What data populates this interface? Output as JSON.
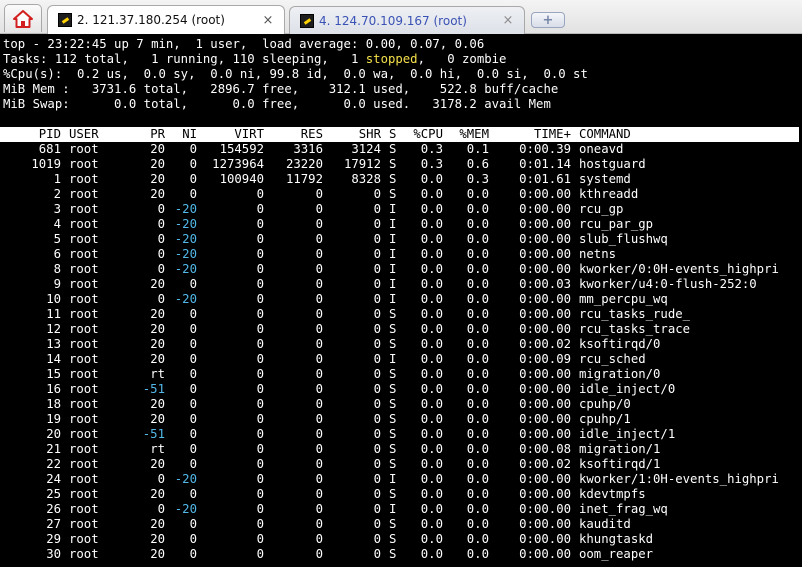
{
  "tabs": [
    {
      "label": "2. 121.37.180.254 (root)",
      "close": "×",
      "active": true
    },
    {
      "label": "4. 124.70.109.167 (root)",
      "close": "×",
      "active": false
    }
  ],
  "newtab_label": "+",
  "summary": {
    "top_line": "top - 23:22:45 up 7 min,  1 user,  load average: 0.00, 0.07, 0.06",
    "tasks_prefix": "Tasks: 112 total,   1 running, 110 sleeping,   1 ",
    "tasks_stopped": "stopped",
    "tasks_suffix": ",   0 zombie",
    "cpu_line": "%Cpu(s):  0.2 us,  0.0 sy,  0.0 ni, 99.8 id,  0.0 wa,  0.0 hi,  0.0 si,  0.0 st",
    "mem_line": "MiB Mem :   3731.6 total,   2896.7 free,    312.1 used,    522.8 buff/cache",
    "swap_line": "MiB Swap:      0.0 total,      0.0 free,      0.0 used.   3178.2 avail Mem"
  },
  "columns": [
    "PID",
    "USER",
    "PR",
    "NI",
    "VIRT",
    "RES",
    "SHR",
    "S",
    "%CPU",
    "%MEM",
    "TIME+",
    "COMMAND"
  ],
  "processes": [
    [
      "681",
      "root",
      "20",
      "0",
      "154592",
      "3316",
      "3124",
      "S",
      "0.3",
      "0.1",
      "0:00.39",
      "oneavd"
    ],
    [
      "1019",
      "root",
      "20",
      "0",
      "1273964",
      "23220",
      "17912",
      "S",
      "0.3",
      "0.6",
      "0:01.14",
      "hostguard"
    ],
    [
      "1",
      "root",
      "20",
      "0",
      "100940",
      "11792",
      "8328",
      "S",
      "0.0",
      "0.3",
      "0:01.61",
      "systemd"
    ],
    [
      "2",
      "root",
      "20",
      "0",
      "0",
      "0",
      "0",
      "S",
      "0.0",
      "0.0",
      "0:00.00",
      "kthreadd"
    ],
    [
      "3",
      "root",
      "0",
      "-20",
      "0",
      "0",
      "0",
      "I",
      "0.0",
      "0.0",
      "0:00.00",
      "rcu_gp"
    ],
    [
      "4",
      "root",
      "0",
      "-20",
      "0",
      "0",
      "0",
      "I",
      "0.0",
      "0.0",
      "0:00.00",
      "rcu_par_gp"
    ],
    [
      "5",
      "root",
      "0",
      "-20",
      "0",
      "0",
      "0",
      "I",
      "0.0",
      "0.0",
      "0:00.00",
      "slub_flushwq"
    ],
    [
      "6",
      "root",
      "0",
      "-20",
      "0",
      "0",
      "0",
      "I",
      "0.0",
      "0.0",
      "0:00.00",
      "netns"
    ],
    [
      "8",
      "root",
      "0",
      "-20",
      "0",
      "0",
      "0",
      "I",
      "0.0",
      "0.0",
      "0:00.00",
      "kworker/0:0H-events_highpri"
    ],
    [
      "9",
      "root",
      "20",
      "0",
      "0",
      "0",
      "0",
      "I",
      "0.0",
      "0.0",
      "0:00.03",
      "kworker/u4:0-flush-252:0"
    ],
    [
      "10",
      "root",
      "0",
      "-20",
      "0",
      "0",
      "0",
      "I",
      "0.0",
      "0.0",
      "0:00.00",
      "mm_percpu_wq"
    ],
    [
      "11",
      "root",
      "20",
      "0",
      "0",
      "0",
      "0",
      "S",
      "0.0",
      "0.0",
      "0:00.00",
      "rcu_tasks_rude_"
    ],
    [
      "12",
      "root",
      "20",
      "0",
      "0",
      "0",
      "0",
      "S",
      "0.0",
      "0.0",
      "0:00.00",
      "rcu_tasks_trace"
    ],
    [
      "13",
      "root",
      "20",
      "0",
      "0",
      "0",
      "0",
      "S",
      "0.0",
      "0.0",
      "0:00.02",
      "ksoftirqd/0"
    ],
    [
      "14",
      "root",
      "20",
      "0",
      "0",
      "0",
      "0",
      "I",
      "0.0",
      "0.0",
      "0:00.09",
      "rcu_sched"
    ],
    [
      "15",
      "root",
      "rt",
      "0",
      "0",
      "0",
      "0",
      "S",
      "0.0",
      "0.0",
      "0:00.00",
      "migration/0"
    ],
    [
      "16",
      "root",
      "-51",
      "0",
      "0",
      "0",
      "0",
      "S",
      "0.0",
      "0.0",
      "0:00.00",
      "idle_inject/0"
    ],
    [
      "18",
      "root",
      "20",
      "0",
      "0",
      "0",
      "0",
      "S",
      "0.0",
      "0.0",
      "0:00.00",
      "cpuhp/0"
    ],
    [
      "19",
      "root",
      "20",
      "0",
      "0",
      "0",
      "0",
      "S",
      "0.0",
      "0.0",
      "0:00.00",
      "cpuhp/1"
    ],
    [
      "20",
      "root",
      "-51",
      "0",
      "0",
      "0",
      "0",
      "S",
      "0.0",
      "0.0",
      "0:00.00",
      "idle_inject/1"
    ],
    [
      "21",
      "root",
      "rt",
      "0",
      "0",
      "0",
      "0",
      "S",
      "0.0",
      "0.0",
      "0:00.08",
      "migration/1"
    ],
    [
      "22",
      "root",
      "20",
      "0",
      "0",
      "0",
      "0",
      "S",
      "0.0",
      "0.0",
      "0:00.02",
      "ksoftirqd/1"
    ],
    [
      "24",
      "root",
      "0",
      "-20",
      "0",
      "0",
      "0",
      "I",
      "0.0",
      "0.0",
      "0:00.00",
      "kworker/1:0H-events_highpri"
    ],
    [
      "25",
      "root",
      "20",
      "0",
      "0",
      "0",
      "0",
      "S",
      "0.0",
      "0.0",
      "0:00.00",
      "kdevtmpfs"
    ],
    [
      "26",
      "root",
      "0",
      "-20",
      "0",
      "0",
      "0",
      "I",
      "0.0",
      "0.0",
      "0:00.00",
      "inet_frag_wq"
    ],
    [
      "27",
      "root",
      "20",
      "0",
      "0",
      "0",
      "0",
      "S",
      "0.0",
      "0.0",
      "0:00.00",
      "kauditd"
    ],
    [
      "29",
      "root",
      "20",
      "0",
      "0",
      "0",
      "0",
      "S",
      "0.0",
      "0.0",
      "0:00.00",
      "khungtaskd"
    ],
    [
      "30",
      "root",
      "20",
      "0",
      "0",
      "0",
      "0",
      "S",
      "0.0",
      "0.0",
      "0:00.00",
      "oom_reaper"
    ]
  ],
  "icons": {
    "home": "home-icon",
    "session": "terminal-session-icon",
    "new_tab": "new-tab-icon"
  },
  "colors": {
    "negative_value": "#52b8e8",
    "stopped": "#f4e04a",
    "header_bg": "#ffffff",
    "terminal_bg": "#000000"
  }
}
